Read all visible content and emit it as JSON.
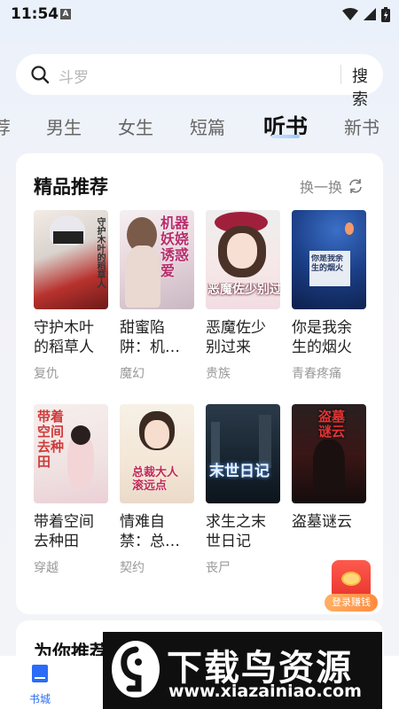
{
  "status": {
    "time": "11:54",
    "notify_letter": "A"
  },
  "search": {
    "placeholder": "斗罗",
    "button": "搜索"
  },
  "tabs": [
    {
      "label": "荐",
      "active": false
    },
    {
      "label": "男生",
      "active": false
    },
    {
      "label": "女生",
      "active": false
    },
    {
      "label": "短篇",
      "active": false
    },
    {
      "label": "听书",
      "active": true
    },
    {
      "label": "新书",
      "active": false
    }
  ],
  "featured": {
    "title": "精品推荐",
    "refresh_label": "换一换",
    "books": [
      {
        "title": "守护木叶的稻草人",
        "tag": "复仇",
        "cover_text": "守护木叶的稻草人"
      },
      {
        "title": "甜蜜陷阱：机…",
        "tag": "魔幻",
        "cover_text": "机器妖娆诱惑爱"
      },
      {
        "title": "恶魔佐少别过来",
        "tag": "贵族",
        "cover_text": "恶魔佐少别过来"
      },
      {
        "title": "你是我余生的烟火",
        "tag": "青春疼痛",
        "cover_text": "你是我余生的烟火"
      },
      {
        "title": "带着空间去种田",
        "tag": "穿越",
        "cover_text": "带着空间去种田"
      },
      {
        "title": "情难自禁：总…",
        "tag": "契约",
        "cover_text": "总裁大人滚远点"
      },
      {
        "title": "求生之末世日记",
        "tag": "丧尸",
        "cover_text": "末世日记"
      },
      {
        "title": "盗墓谜云",
        "tag": "",
        "cover_text": "盗墓谜云"
      }
    ]
  },
  "recommend": {
    "title": "为你推荐"
  },
  "redpacket": {
    "label": "登录赚钱"
  },
  "bottom_nav": {
    "home_label": "书城"
  },
  "watermark": {
    "text": "下载鸟资源",
    "url": "www.xiazainiao.com"
  },
  "colors": {
    "accent": "#2a6cf6",
    "card_bg": "#ffffff",
    "page_bg": "#f1f2f8"
  }
}
